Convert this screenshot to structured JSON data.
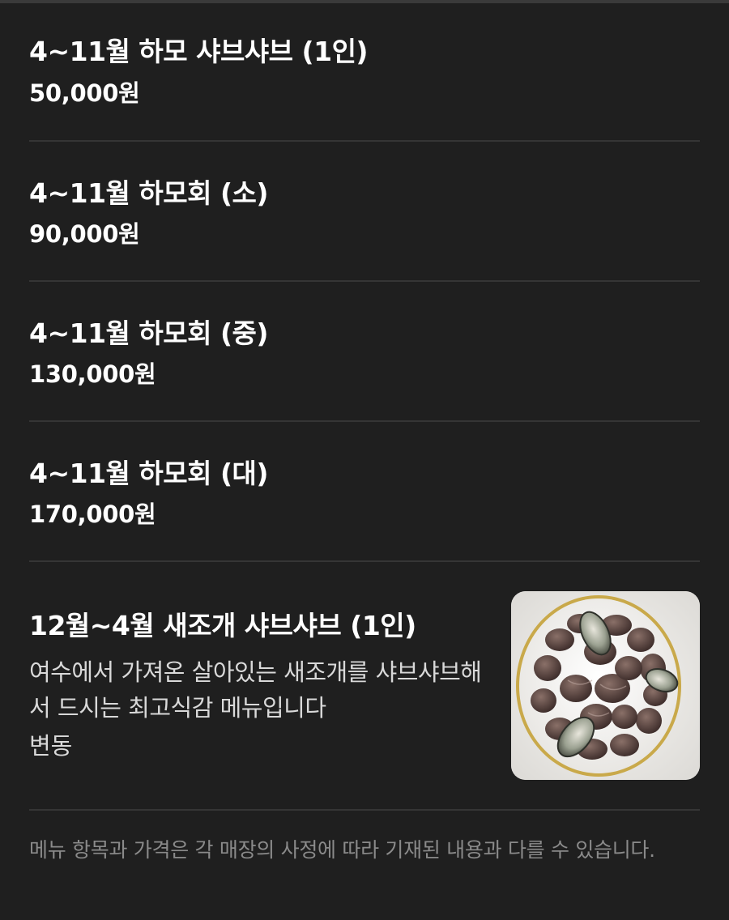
{
  "menu": {
    "items": [
      {
        "name": "4~11월 하모 샤브샤브 (1인)",
        "price": "50,000원"
      },
      {
        "name": "4~11월 하모회 (소)",
        "price": "90,000원"
      },
      {
        "name": "4~11월 하모회 (중)",
        "price": "130,000원"
      },
      {
        "name": "4~11월 하모회 (대)",
        "price": "170,000원"
      }
    ],
    "featured": {
      "name": "12월~4월 새조개 샤브샤브 (1인)",
      "description": "여수에서 가져온 살아있는 새조개를 샤브샤브해서 드시는 최고식감 메뉴입니다",
      "price_note": "변동",
      "image_alt": "plate of cockles with shiitake mushrooms and abalone"
    }
  },
  "footer": {
    "note": "메뉴 항목과 가격은 각 매장의 사정에 따라 기재된 내용과 다를 수 있습니다."
  },
  "colors": {
    "background": "#1f1f1f",
    "divider": "#353535",
    "text": "#ffffff",
    "muted": "#8a8a8a"
  }
}
